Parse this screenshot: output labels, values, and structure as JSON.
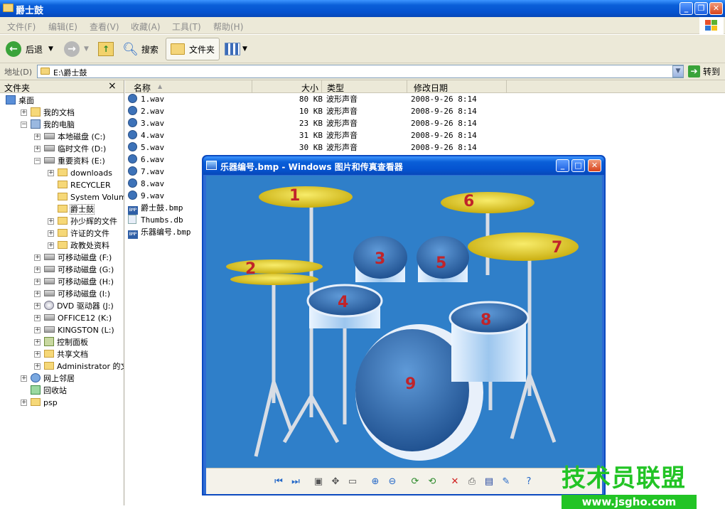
{
  "window": {
    "title": "爵士鼓"
  },
  "menu": [
    "文件(F)",
    "编辑(E)",
    "查看(V)",
    "收藏(A)",
    "工具(T)",
    "帮助(H)"
  ],
  "toolbar": {
    "back": "后退",
    "search": "搜索",
    "folders": "文件夹"
  },
  "address": {
    "label": "地址(D)",
    "value": "E:\\爵士鼓",
    "go": "转到"
  },
  "leftpane": {
    "header": "文件夹",
    "close": "×",
    "items": [
      "桌面",
      "我的文档",
      "我的电脑",
      "本地磁盘 (C:)",
      "临时文件 (D:)",
      "重要资料 (E:)",
      "downloads",
      "RECYCLER",
      "System Volume In",
      "爵士鼓",
      "孙少辉的文件",
      "许证的文件",
      "政教处资料",
      "可移动磁盘 (F:)",
      "可移动磁盘 (G:)",
      "可移动磁盘 (H:)",
      "可移动磁盘 (I:)",
      "DVD 驱动器 (J:)",
      "OFFICE12 (K:)",
      "KINGSTON (L:)",
      "控制面板",
      "共享文档",
      "Administrator 的文档",
      "网上邻居",
      "回收站",
      "psp"
    ]
  },
  "columns": {
    "name": "名称",
    "size": "大小",
    "type": "类型",
    "date": "修改日期"
  },
  "files": [
    {
      "name": "1.wav",
      "size": "80 KB",
      "type": "波形声音",
      "date": "2008-9-26 8:14"
    },
    {
      "name": "2.wav",
      "size": "10 KB",
      "type": "波形声音",
      "date": "2008-9-26 8:14"
    },
    {
      "name": "3.wav",
      "size": "23 KB",
      "type": "波形声音",
      "date": "2008-9-26 8:14"
    },
    {
      "name": "4.wav",
      "size": "31 KB",
      "type": "波形声音",
      "date": "2008-9-26 8:14"
    },
    {
      "name": "5.wav",
      "size": "30 KB",
      "type": "波形声音",
      "date": "2008-9-26 8:14"
    },
    {
      "name": "6.wav",
      "size": "",
      "type": "",
      "date": ""
    },
    {
      "name": "7.wav",
      "size": "",
      "type": "",
      "date": ""
    },
    {
      "name": "8.wav",
      "size": "",
      "type": "",
      "date": ""
    },
    {
      "name": "9.wav",
      "size": "",
      "type": "",
      "date": ""
    },
    {
      "name": "爵士鼓.bmp",
      "size": "",
      "type": "",
      "date": ""
    },
    {
      "name": "Thumbs.db",
      "size": "",
      "type": "",
      "date": ""
    },
    {
      "name": "乐器编号.bmp",
      "size": "",
      "type": "",
      "date": ""
    }
  ],
  "viewer": {
    "title": "乐器编号.bmp - Windows 图片和传真查看器",
    "drum_numbers": [
      "1",
      "2",
      "3",
      "4",
      "5",
      "6",
      "7",
      "8",
      "9"
    ]
  },
  "watermark": {
    "cn": "技术员联盟",
    "url": "www.jsgho.com"
  }
}
